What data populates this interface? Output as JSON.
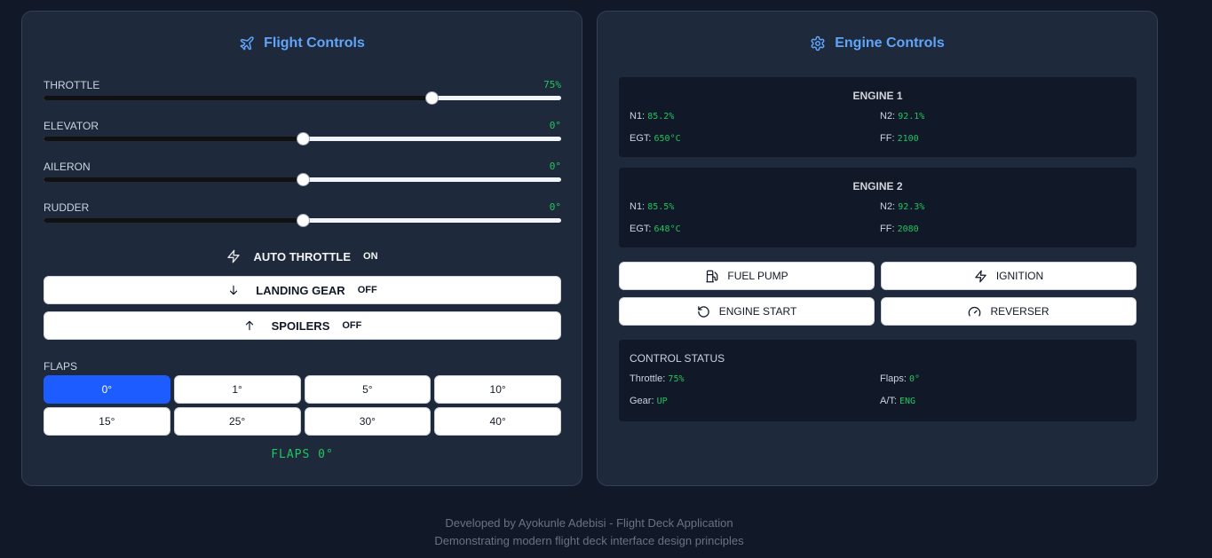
{
  "flight": {
    "title": "Flight Controls",
    "sliders": [
      {
        "label": "THROTTLE",
        "value": "75%",
        "fraction": 0.75
      },
      {
        "label": "ELEVATOR",
        "value": "0°",
        "fraction": 0.5
      },
      {
        "label": "AILERON",
        "value": "0°",
        "fraction": 0.5
      },
      {
        "label": "RUDDER",
        "value": "0°",
        "fraction": 0.5
      }
    ],
    "auto_throttle": {
      "label": "AUTO THROTTLE",
      "state": "ON"
    },
    "landing_gear": {
      "label": "LANDING GEAR",
      "state": "OFF"
    },
    "spoilers": {
      "label": "SPOILERS",
      "state": "OFF"
    },
    "flaps_label": "FLAPS",
    "flaps": [
      "0°",
      "1°",
      "5°",
      "10°",
      "15°",
      "25°",
      "30°",
      "40°"
    ],
    "flaps_selected": "0°",
    "flaps_readout": "FLAPS 0°"
  },
  "engine": {
    "title": "Engine Controls",
    "engines": [
      {
        "name": "ENGINE 1",
        "n1_label": "N1:",
        "n1": "85.2%",
        "n2_label": "N2:",
        "n2": "92.1%",
        "egt_label": "EGT:",
        "egt": "650°C",
        "ff_label": "FF:",
        "ff": "2100"
      },
      {
        "name": "ENGINE 2",
        "n1_label": "N1:",
        "n1": "85.5%",
        "n2_label": "N2:",
        "n2": "92.3%",
        "egt_label": "EGT:",
        "egt": "648°C",
        "ff_label": "FF:",
        "ff": "2080"
      }
    ],
    "buttons": {
      "fuel_pump": "FUEL PUMP",
      "ignition": "IGNITION",
      "engine_start": "ENGINE START",
      "reverser": "REVERSER"
    },
    "status": {
      "title": "CONTROL STATUS",
      "throttle_label": "Throttle:",
      "throttle": "75%",
      "flaps_label": "Flaps:",
      "flaps": "0°",
      "gear_label": "Gear:",
      "gear": "UP",
      "at_label": "A/T:",
      "at": "ENG"
    }
  },
  "footer": {
    "line1": "Developed by Ayokunle Adebisi - Flight Deck Application",
    "line2": "Demonstrating modern flight deck interface design principles"
  },
  "colors": {
    "accent": "#60a5fa",
    "value_green": "#22c55e",
    "active_flap": "#1d5cff",
    "background": "#111827",
    "panel": "#1e293b"
  },
  "icons": {
    "flight_title": "plane-icon",
    "engine_title": "gear-icon",
    "auto_throttle": "lightning-icon",
    "landing_gear": "arrow-down-icon",
    "spoilers": "arrow-up-icon",
    "fuel_pump": "fuel-icon",
    "ignition": "lightning-icon",
    "engine_start": "rotate-icon",
    "reverser": "gauge-icon"
  }
}
